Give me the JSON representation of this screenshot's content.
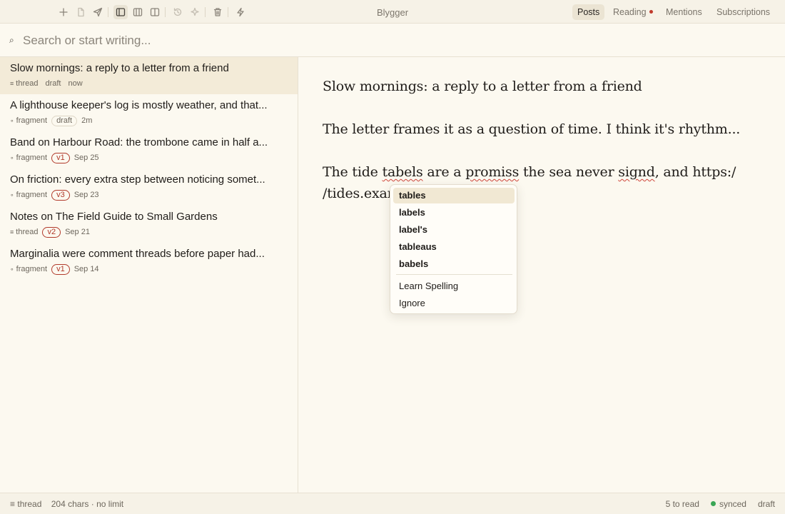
{
  "app": {
    "title": "Blygger"
  },
  "toolbar": {
    "icons": [
      "plus-icon",
      "document-icon",
      "send-icon",
      "sidebar-left-icon",
      "columns-icon",
      "sidebar-right-icon",
      "history-icon",
      "sparkle-icon",
      "trash-icon",
      "lightning-icon"
    ]
  },
  "nav": {
    "tabs": [
      {
        "label": "Posts",
        "active": true
      },
      {
        "label": "Reading",
        "badge": true
      },
      {
        "label": "Mentions"
      },
      {
        "label": "Subscriptions"
      }
    ]
  },
  "search": {
    "placeholder": "Search or start writing...",
    "value": ""
  },
  "posts": [
    {
      "title": "Slow mornings: a reply to a letter from a friend",
      "kind_icon": "≡",
      "kind": "thread",
      "status": "draft",
      "status_style": "plain",
      "time": "now",
      "selected": true
    },
    {
      "title": "A lighthouse keeper's log is mostly weather, and that...",
      "kind_icon": "∘",
      "kind": "fragment",
      "status": "draft",
      "status_style": "pill",
      "time": "2m"
    },
    {
      "title": "Band on Harbour Road: the trombone came in half a...",
      "kind_icon": "∘",
      "kind": "fragment",
      "status": "v1",
      "status_style": "version",
      "time": "Sep 25"
    },
    {
      "title": "On friction: every extra step between noticing somet...",
      "kind_icon": "∘",
      "kind": "fragment",
      "status": "v3",
      "status_style": "version",
      "time": "Sep 23"
    },
    {
      "title": "Notes on The Field Guide to Small Gardens",
      "kind_icon": "≡",
      "kind": "thread",
      "status": "v2",
      "status_style": "version",
      "time": "Sep 21"
    },
    {
      "title": "Marginalia were comment threads before paper had...",
      "kind_icon": "∘",
      "kind": "fragment",
      "status": "v1",
      "status_style": "version",
      "time": "Sep 14"
    }
  ],
  "editor": {
    "title": "Slow mornings: a reply to a letter from a friend",
    "paragraph1": "The letter frames it as a question of time. I think it's rhythm...",
    "p3": {
      "a": "The tide ",
      "b": "tabels",
      "c": " are a ",
      "d": "promiss",
      "e": " the sea never ",
      "f": "signd",
      "g": ", and https:/",
      "line2": "/tides.exam"
    }
  },
  "spell_menu": {
    "suggestions": [
      "tables",
      "labels",
      "label's",
      "tableaus",
      "babels"
    ],
    "actions": [
      "Learn Spelling",
      "Ignore"
    ]
  },
  "status": {
    "kind_icon": "≡",
    "kind": "thread",
    "chars": "204 chars · no limit",
    "to_read": "5 to read",
    "sync": "synced",
    "state": "draft"
  }
}
